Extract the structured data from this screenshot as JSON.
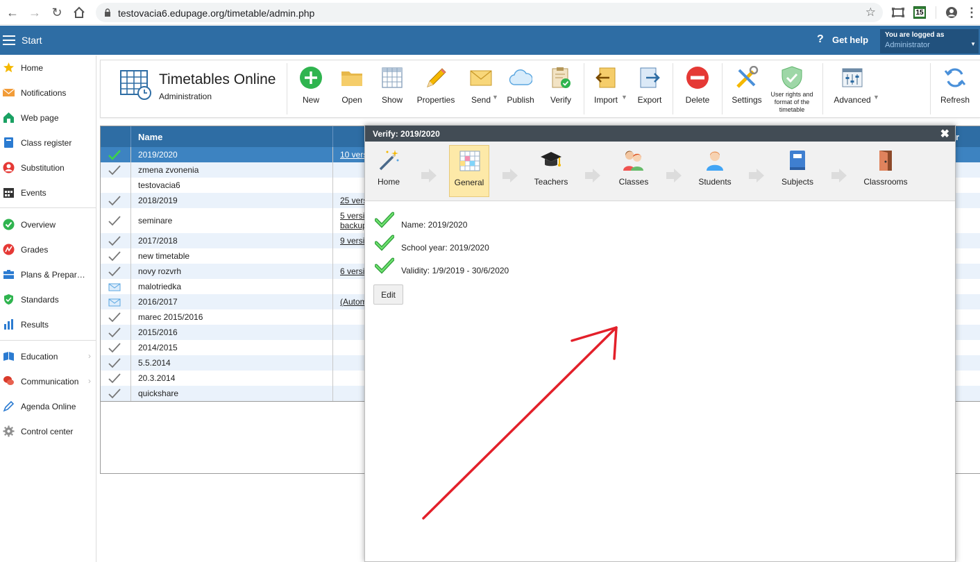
{
  "browser": {
    "url": "testovacia6.edupage.org/timetable/admin.php",
    "ext_badge": "15"
  },
  "header": {
    "start": "Start",
    "help": "Get help",
    "login_line1": "You are logged as",
    "login_line2": "Administrator"
  },
  "sidebar": {
    "items": [
      {
        "label": "Home",
        "icon": "star-icon"
      },
      {
        "label": "Notifications",
        "icon": "envelope-icon"
      },
      {
        "label": "Web page",
        "icon": "house-icon"
      },
      {
        "label": "Class register",
        "icon": "book-icon"
      },
      {
        "label": "Substitution",
        "icon": "person-icon"
      },
      {
        "label": "Events",
        "icon": "calendar-icon"
      },
      {
        "label": "Overview",
        "icon": "check-circle-icon"
      },
      {
        "label": "Grades",
        "icon": "grades-icon"
      },
      {
        "label": "Plans & Prepar…",
        "icon": "briefcase-icon"
      },
      {
        "label": "Standards",
        "icon": "shield-icon"
      },
      {
        "label": "Results",
        "icon": "bar-chart-icon"
      },
      {
        "label": "Education",
        "icon": "education-icon"
      },
      {
        "label": "Communication",
        "icon": "chat-icon"
      },
      {
        "label": "Agenda Online",
        "icon": "pen-icon"
      },
      {
        "label": "Control center",
        "icon": "gear-icon"
      }
    ]
  },
  "toolbar": {
    "title": "Timetables Online",
    "subtitle": "Administration",
    "new": "New",
    "open": "Open",
    "show": "Show",
    "properties": "Properties",
    "send": "Send",
    "publish": "Publish",
    "verify": "Verify",
    "import": "Import",
    "export": "Export",
    "delete": "Delete",
    "settings": "Settings",
    "user_rights_1": "User rights and",
    "user_rights_2": "format of the",
    "user_rights_3": "timetable",
    "advanced": "Advanced",
    "refresh": "Refresh"
  },
  "table": {
    "header_name": "Name",
    "header_right": "r",
    "rows": [
      {
        "name": "2019/2020",
        "versions": "10 versi",
        "check": "green"
      },
      {
        "name": "zmena zvonenia",
        "versions": "",
        "check": "gray"
      },
      {
        "name": "testovacia6",
        "versions": "",
        "check": "none"
      },
      {
        "name": "2018/2019",
        "versions": "25 vers",
        "check": "gray"
      },
      {
        "name": "seminare",
        "versions": "5 versi",
        "versions2": "backup",
        "check": "gray"
      },
      {
        "name": "2017/2018",
        "versions": "9 versi",
        "check": "gray"
      },
      {
        "name": "new timetable",
        "versions": "",
        "check": "gray"
      },
      {
        "name": "novy rozvrh",
        "versions": "6 versi",
        "check": "gray"
      },
      {
        "name": "malotriedka",
        "versions": "",
        "check": "mail"
      },
      {
        "name": "2016/2017",
        "versions": "(Autom",
        "check": "mail"
      },
      {
        "name": "marec 2015/2016",
        "versions": "",
        "check": "gray"
      },
      {
        "name": "2015/2016",
        "versions": "",
        "check": "gray"
      },
      {
        "name": "2014/2015",
        "versions": "",
        "check": "gray"
      },
      {
        "name": "5.5.2014",
        "versions": "",
        "check": "gray"
      },
      {
        "name": "20.3.2014",
        "versions": "",
        "check": "gray"
      },
      {
        "name": "quickshare",
        "versions": "",
        "check": "gray"
      }
    ]
  },
  "dialog": {
    "title": "Verify: 2019/2020",
    "steps": [
      "Home",
      "General",
      "Teachers",
      "Classes",
      "Students",
      "Subjects",
      "Classrooms"
    ],
    "active_step": "General",
    "checks": [
      "Name: 2019/2020",
      "School year: 2019/2020",
      "Validity: 1/9/2019 - 30/6/2020"
    ],
    "edit": "Edit"
  },
  "colors": {
    "header_blue": "#2e6da4",
    "selected_row": "#3d83c1",
    "alt_row": "#eaf2fb",
    "annotation_red": "#e3202a"
  }
}
